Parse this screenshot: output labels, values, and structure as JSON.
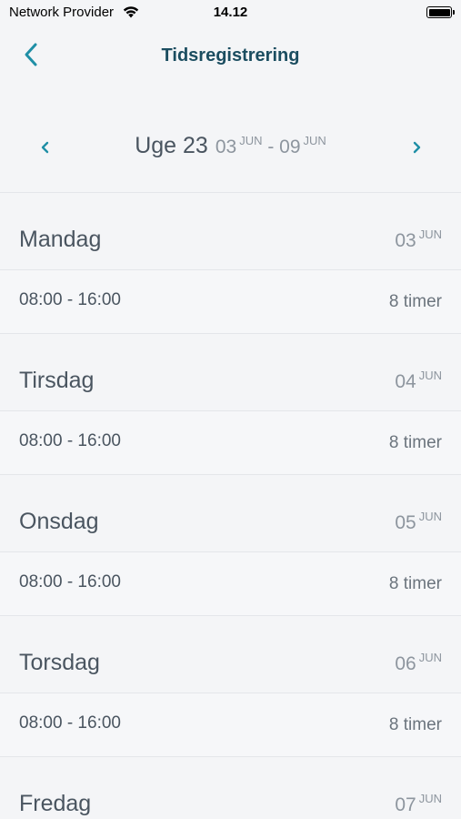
{
  "status_bar": {
    "carrier": "Network Provider",
    "time": "14.12"
  },
  "nav": {
    "title": "Tidsregistrering"
  },
  "week": {
    "label": "Uge 23",
    "start_day": "03",
    "start_month": "JUN",
    "separator": "-",
    "end_day": "09",
    "end_month": "JUN"
  },
  "days": [
    {
      "name": "Mandag",
      "date_day": "03",
      "date_month": "JUN",
      "time": "08:00 - 16:00",
      "hours": "8 timer"
    },
    {
      "name": "Tirsdag",
      "date_day": "04",
      "date_month": "JUN",
      "time": "08:00 - 16:00",
      "hours": "8 timer"
    },
    {
      "name": "Onsdag",
      "date_day": "05",
      "date_month": "JUN",
      "time": "08:00 - 16:00",
      "hours": "8 timer"
    },
    {
      "name": "Torsdag",
      "date_day": "06",
      "date_month": "JUN",
      "time": "08:00 - 16:00",
      "hours": "8 timer"
    },
    {
      "name": "Fredag",
      "date_day": "07",
      "date_month": "JUN"
    }
  ],
  "colors": {
    "accent": "#1f8fa6",
    "title": "#1b4d60",
    "background": "#f4f5f7"
  },
  "icons": {
    "back": "chevron-left-icon",
    "prev_week": "chevron-left-icon",
    "next_week": "chevron-right-icon",
    "wifi": "wifi-icon",
    "battery": "battery-icon"
  }
}
